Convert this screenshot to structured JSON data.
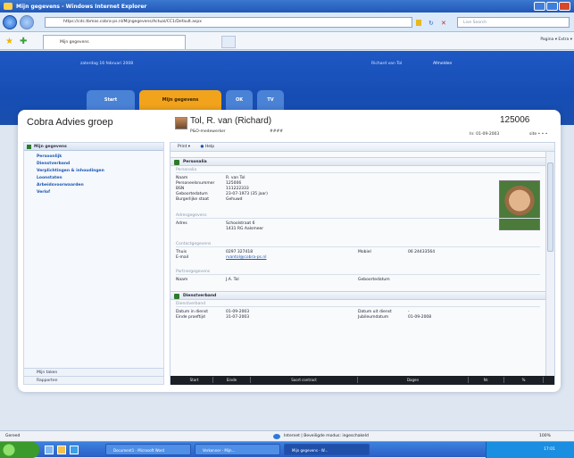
{
  "window": {
    "title": "Mijn gegevens - Windows Internet Explorer"
  },
  "browser": {
    "address": "https://cdc.tbmas.cobra-ps.nl/Mijngegevens/Actual/CC1/Default.aspx",
    "search_placeholder": "Live Search",
    "tab_title": "Mijn gegevens",
    "tab_tools": "Pagina ▾  Extra ▾"
  },
  "banner": {
    "date": "zaterdag 16 februari 2008",
    "user": "Richard van Tol",
    "logout": "Afmelden"
  },
  "nav_tabs": [
    "Start",
    "Mijn gegevens",
    "OK",
    "TV"
  ],
  "org_name": "Cobra Advies groep",
  "left_panel": {
    "header": "Mijn gegevens",
    "items": [
      "Persoonlijk",
      "Dienstverband",
      "Verplichtingen & inhoudingen",
      "Loonstaten",
      "Arbeidsvoorwaarden",
      "Verlof"
    ],
    "footer": [
      "Mijn taken",
      "Rapporten"
    ]
  },
  "person": {
    "name": "Tol, R. van (Richard)",
    "role": "P&O-medewerker",
    "code": "####",
    "id": "125006",
    "date": "In: 01-09-2003",
    "more": "site  • • •"
  },
  "toolbar": {
    "print": "Print ▾",
    "help": "Help"
  },
  "sections": {
    "personalia": "Personalia",
    "dienstverband": "Dienstverband"
  },
  "subheads": {
    "personalia": "Personalia",
    "adres": "Adresgegevens",
    "contact": "Contactgegevens",
    "partner": "Partnergegevens",
    "dienst": "Dienstverband"
  },
  "personalia": [
    {
      "label": "Naam",
      "value": "R. van Tol"
    },
    {
      "label": "Personeelsnummer",
      "value": "125006"
    },
    {
      "label": "BSN",
      "value": "111222333"
    },
    {
      "label": "Geboortedatum",
      "value": "23-07-1973 (35 jaar)"
    },
    {
      "label": "Burgerlijke staat",
      "value": "Gehuwd"
    }
  ],
  "adres": [
    {
      "label": "Adres",
      "value": "Schoolstraat 6"
    },
    {
      "label": "",
      "value": "1431 RG   Aalsmeer"
    }
  ],
  "contact": {
    "thuis_label": "Thuis",
    "thuis": "0297 327418",
    "email_label": "E-mail",
    "email": "rvantol@cobra-ps.nl",
    "mobiel_label": "Mobiel",
    "mobiel": "06 24433564"
  },
  "partner": {
    "naam_label": "Naam",
    "naam": "J.A. Tol",
    "geb_label": "Geboortedatum",
    "geb": ""
  },
  "dienst": {
    "in_label": "Datum in dienst",
    "in": "01-09-2003",
    "proef_label": "Einde proeftijd",
    "proef": "31-07-2003",
    "uit_label": "Datum uit dienst",
    "uit": "-",
    "jub_label": "Jubileumdatum",
    "jub": "01-09-2008"
  },
  "bottom_bar": [
    "Start",
    "Einde",
    "Soort contract",
    "Dagen",
    "Nr.",
    "%"
  ],
  "statusbar": {
    "left": "Gereed",
    "center": "Internet | Beveiligde modus: ingeschakeld",
    "zoom": "100%"
  },
  "taskbar": {
    "tasks": [
      "Document1 - Microsoft Word",
      "Verkenner - Mijn...",
      "Mijn gegevens - W..."
    ],
    "clock": "17:01"
  }
}
